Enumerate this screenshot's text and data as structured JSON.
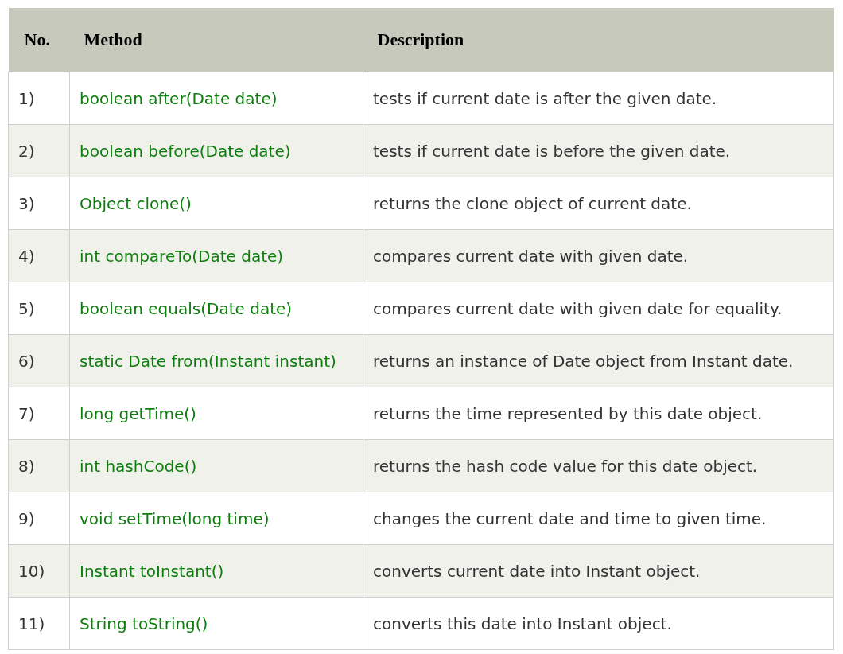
{
  "table": {
    "columns": [
      "No.",
      "Method",
      "Description"
    ],
    "rows": [
      {
        "no": "1)",
        "method": "boolean after(Date date)",
        "description": "tests if current date is after the given date."
      },
      {
        "no": "2)",
        "method": "boolean before(Date date)",
        "description": "tests if current date is before the given date."
      },
      {
        "no": "3)",
        "method": "Object clone()",
        "description": "returns the clone object of current date."
      },
      {
        "no": "4)",
        "method": "int compareTo(Date date)",
        "description": "compares current date with given date."
      },
      {
        "no": "5)",
        "method": "boolean equals(Date date)",
        "description": "compares current date with given date for equality."
      },
      {
        "no": "6)",
        "method": "static Date from(Instant instant)",
        "description": "returns an instance of Date object from Instant date."
      },
      {
        "no": "7)",
        "method": "long getTime()",
        "description": "returns the time represented by this date object."
      },
      {
        "no": "8)",
        "method": "int hashCode()",
        "description": "returns the hash code value for this date object."
      },
      {
        "no": "9)",
        "method": "void setTime(long time)",
        "description": "changes the current date and time to given time."
      },
      {
        "no": "10)",
        "method": "Instant toInstant()",
        "description": "converts current date into Instant object."
      },
      {
        "no": "11)",
        "method": "String toString()",
        "description": "converts this date into Instant object."
      }
    ]
  }
}
